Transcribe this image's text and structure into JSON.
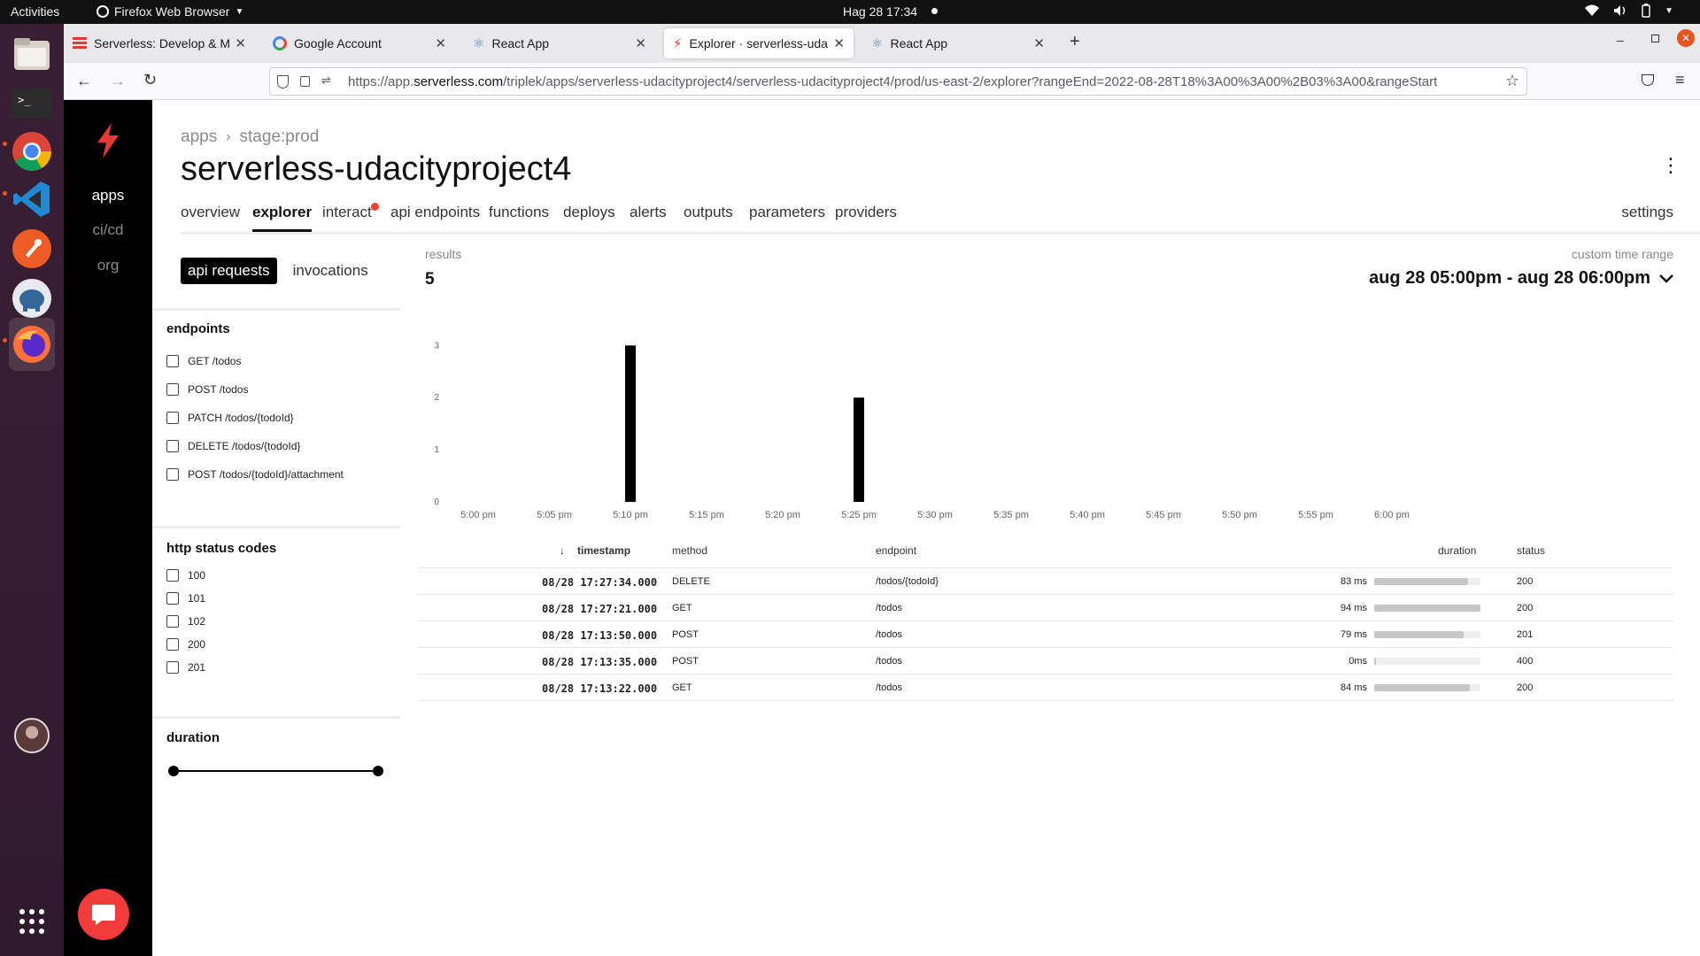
{
  "topbar": {
    "activities": "Activities",
    "app_menu": "Firefox Web Browser",
    "clock": "Hag 28  17:34"
  },
  "browser": {
    "tabs": [
      {
        "title": "Serverless: Develop & Mo",
        "icon": "serverless-icon"
      },
      {
        "title": "Google Account",
        "icon": "google-icon"
      },
      {
        "title": "React App",
        "icon": "react-icon"
      },
      {
        "title": "Explorer · serverless-uda",
        "icon": "serverless-icon"
      },
      {
        "title": "React App",
        "icon": "react-icon"
      }
    ],
    "url_prefix": "https://app.",
    "url_host": "serverless.com",
    "url_rest": "/triplek/apps/serverless-udacityproject4/serverless-udacityproject4/prod/us-east-2/explorer?rangeEnd=2022-08-28T18%3A00%3A00%2B03%3A00&rangeStart"
  },
  "app_nav": {
    "apps": "apps",
    "cicd": "ci/cd",
    "org": "org"
  },
  "header": {
    "breadcrumb_root": "apps",
    "breadcrumb_stage": "stage:prod",
    "title": "serverless-udacityproject4"
  },
  "page_tabs": [
    "overview",
    "explorer",
    "interact",
    "api endpoints",
    "functions",
    "deploys",
    "alerts",
    "outputs",
    "parameters",
    "providers"
  ],
  "settings_label": "settings",
  "filters": {
    "toggle": [
      "api requests",
      "invocations"
    ],
    "endpoints_heading": "endpoints",
    "endpoints": [
      "GET /todos",
      "POST /todos",
      "PATCH /todos/{todoId}",
      "DELETE /todos/{todoId}",
      "POST /todos/{todoId}/attachment"
    ],
    "status_heading": "http status codes",
    "status_codes": [
      "100",
      "101",
      "102",
      "200",
      "201"
    ],
    "duration_heading": "duration"
  },
  "results": {
    "label": "results",
    "count": "5",
    "range_label": "custom time range",
    "range_value": "aug 28 05:00pm - aug 28 06:00pm"
  },
  "chart_data": {
    "type": "bar",
    "categories": [
      "5:00 pm",
      "5:05 pm",
      "5:10 pm",
      "5:15 pm",
      "5:20 pm",
      "5:25 pm",
      "5:30 pm",
      "5:35 pm",
      "5:40 pm",
      "5:45 pm",
      "5:50 pm",
      "5:55 pm",
      "6:00 pm"
    ],
    "values": [
      0,
      0,
      3,
      0,
      0,
      2,
      0,
      0,
      0,
      0,
      0,
      0,
      0
    ],
    "yticks": [
      "0",
      "1",
      "2",
      "3"
    ],
    "ylim": [
      0,
      3
    ],
    "bar_color": "#000000"
  },
  "table": {
    "columns": {
      "timestamp": "timestamp",
      "method": "method",
      "endpoint": "endpoint",
      "duration": "duration",
      "status": "status"
    },
    "rows": [
      {
        "timestamp": "08/28 17:27:34.000",
        "method": "DELETE",
        "endpoint": "/todos/{todoId}",
        "duration": "83 ms",
        "duration_fraction": 0.88,
        "status": "200"
      },
      {
        "timestamp": "08/28 17:27:21.000",
        "method": "GET",
        "endpoint": "/todos",
        "duration": "94 ms",
        "duration_fraction": 1.0,
        "status": "200"
      },
      {
        "timestamp": "08/28 17:13:50.000",
        "method": "POST",
        "endpoint": "/todos",
        "duration": "79 ms",
        "duration_fraction": 0.84,
        "status": "201"
      },
      {
        "timestamp": "08/28 17:13:35.000",
        "method": "POST",
        "endpoint": "/todos",
        "duration": "0ms",
        "duration_fraction": 0.0,
        "status": "400"
      },
      {
        "timestamp": "08/28 17:13:22.000",
        "method": "GET",
        "endpoint": "/todos",
        "duration": "84 ms",
        "duration_fraction": 0.9,
        "status": "200"
      }
    ]
  },
  "colors": {
    "accent": "#e53935",
    "notification_dot": "#f44336",
    "chat_button": "#f23c3c"
  }
}
